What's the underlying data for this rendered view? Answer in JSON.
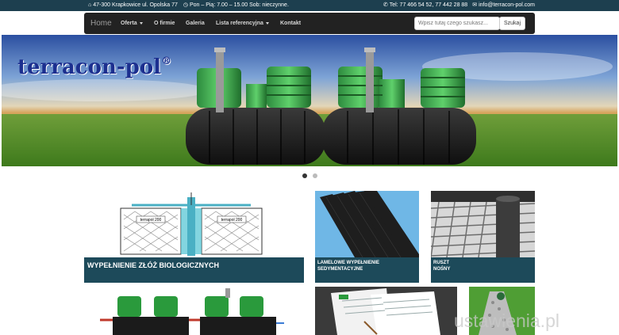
{
  "topbar": {
    "address": "47-300 Krapkowice ul. Opolska 77",
    "hours": "Pon – Pią: 7.00 – 15.00 Sob: nieczynne.",
    "phone": "Tel: 77 466 54 52, 77 442 28 88",
    "email": "info@terracon-pol.com"
  },
  "nav": {
    "home": "Home",
    "items": [
      "Oferta",
      "O firmie",
      "Galeria",
      "Lista referencyjna",
      "Kontakt"
    ],
    "search_placeholder": "Wpisz tutaj czego szukasz...",
    "search_button": "Szukaj"
  },
  "hero": {
    "logo_text": "terracon-pol",
    "logo_mark": "®"
  },
  "tiles": {
    "bio_caption": "WYPEŁNIENIE ZŁÓŻ BIOLOGICZNYCH",
    "bio_tank_label": "terrapol 200",
    "lamel_caption_1": "LAMELOWE WYPEŁNIENIE",
    "lamel_caption_2": "SEDYMENTACYJNE",
    "ruszt_caption_1": "RUSZT",
    "ruszt_caption_2": "NOŚNY"
  },
  "watermark": "ustawienia.pl"
}
